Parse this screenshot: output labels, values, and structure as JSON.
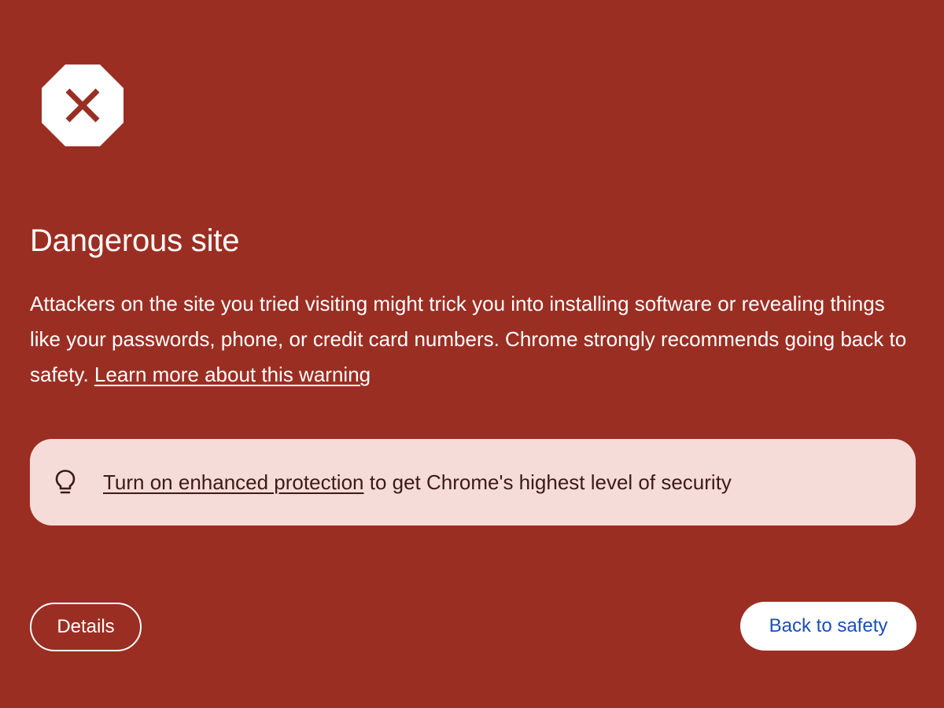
{
  "colors": {
    "background": "#9b2e22",
    "icon_fill": "#ffffff",
    "icon_mark": "#9b2e22",
    "text": "#ffffff",
    "tip_background": "#f6dcd9",
    "tip_text": "#3c1a16",
    "primary_button_text": "#1b4fb3"
  },
  "icons": {
    "warning": "stop-octagon-x-icon",
    "tip": "lightbulb-icon"
  },
  "warning": {
    "title": "Dangerous site",
    "body": "Attackers on the site you tried visiting might trick you into installing software or revealing things like your passwords, phone, or credit card numbers. Chrome strongly recommends going back to safety.",
    "learn_more_link": "Learn more about this warning"
  },
  "tip": {
    "link_text": "Turn on enhanced protection",
    "text": "to get Chrome's highest level of security"
  },
  "buttons": {
    "details": "Details",
    "back_to_safety": "Back to safety"
  }
}
